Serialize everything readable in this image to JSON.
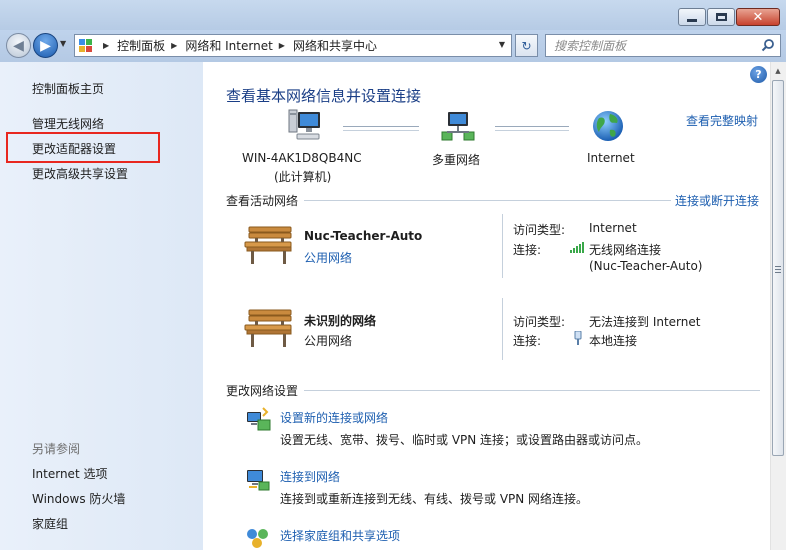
{
  "window": {
    "title_buttons": {
      "minimize_icon": "minimize-icon",
      "maximize_icon": "maximize-icon",
      "close_icon": "close-icon",
      "close_glyph": "✕"
    }
  },
  "navigation": {
    "back_glyph": "◀",
    "forward_glyph": "▶",
    "breadcrumbs": [
      "控制面板",
      "网络和 Internet",
      "网络和共享中心"
    ],
    "separator": "▶",
    "refresh_glyph": "↻",
    "search_placeholder": "搜索控制面板"
  },
  "sidebar": {
    "home": "控制面板主页",
    "items": [
      {
        "label": "管理无线网络"
      },
      {
        "label": "更改适配器设置",
        "highlighted": true
      },
      {
        "label": "更改高级共享设置"
      }
    ],
    "see_also_heading": "另请参阅",
    "see_also": [
      {
        "label": "Internet 选项"
      },
      {
        "label": "Windows 防火墙"
      },
      {
        "label": "家庭组"
      }
    ]
  },
  "main": {
    "help_glyph": "?",
    "title": "查看基本网络信息并设置连接",
    "full_map_link": "查看完整映射",
    "map": {
      "computer_name": "WIN-4AK1D8QB4NC",
      "computer_sub": "(此计算机)",
      "middle": "多重网络",
      "internet": "Internet"
    },
    "active_heading": "查看活动网络",
    "connect_link": "连接或断开连接",
    "networks": [
      {
        "name": "Nuc-Teacher-Auto",
        "category": "公用网络",
        "category_is_link": true,
        "access_type_label": "访问类型:",
        "access_type": "Internet",
        "connection_label": "连接:",
        "connection": "无线网络连接",
        "connection_sub": "(Nuc-Teacher-Auto)",
        "connection_icon": "wifi-signal-icon"
      },
      {
        "name": "未识别的网络",
        "category": "公用网络",
        "category_is_link": false,
        "access_type_label": "访问类型:",
        "access_type": "无法连接到 Internet",
        "connection_label": "连接:",
        "connection": "本地连接",
        "connection_icon": "ethernet-plug-icon"
      }
    ],
    "change_heading": "更改网络设置",
    "tasks": [
      {
        "link": "设置新的连接或网络",
        "desc": "设置无线、宽带、拨号、临时或 VPN 连接；或设置路由器或访问点。"
      },
      {
        "link": "连接到网络",
        "desc": "连接到或重新连接到无线、有线、拨号或 VPN 网络连接。"
      },
      {
        "link": "选择家庭组和共享选项"
      }
    ]
  },
  "colors": {
    "link": "#1e5fb0",
    "title": "#1a3e86",
    "highlight_border": "#e8271f",
    "sidebar_bg": "#e4edf8"
  }
}
